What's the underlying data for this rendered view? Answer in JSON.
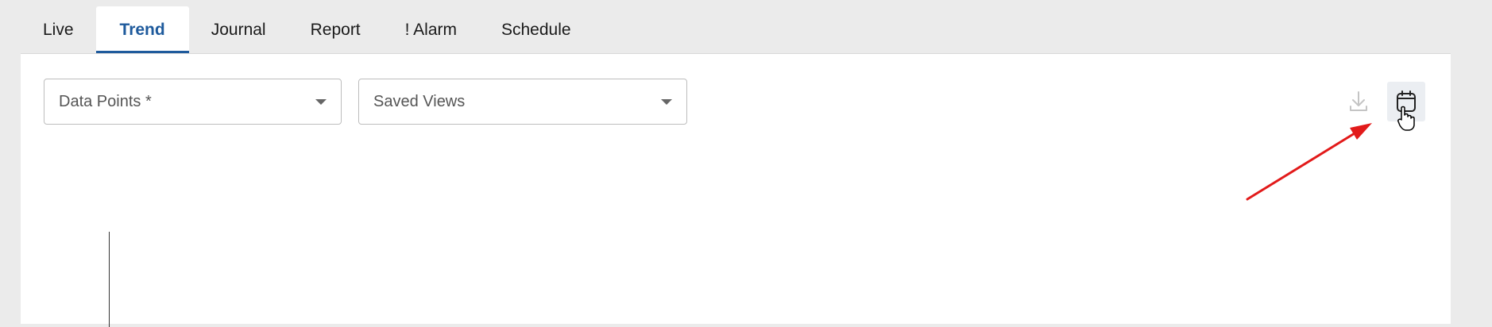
{
  "tabs": [
    {
      "label": "Live",
      "active": false
    },
    {
      "label": "Trend",
      "active": true
    },
    {
      "label": "Journal",
      "active": false
    },
    {
      "label": "Report",
      "active": false
    },
    {
      "label": "! Alarm",
      "active": false
    },
    {
      "label": "Schedule",
      "active": false
    }
  ],
  "toolbar": {
    "data_points_label": "Data Points *",
    "saved_views_label": "Saved Views",
    "download_icon": "download-icon",
    "calendar_icon": "calendar-icon"
  },
  "colors": {
    "accent": "#1e5a9c",
    "annotation_arrow": "#e21a1a"
  }
}
